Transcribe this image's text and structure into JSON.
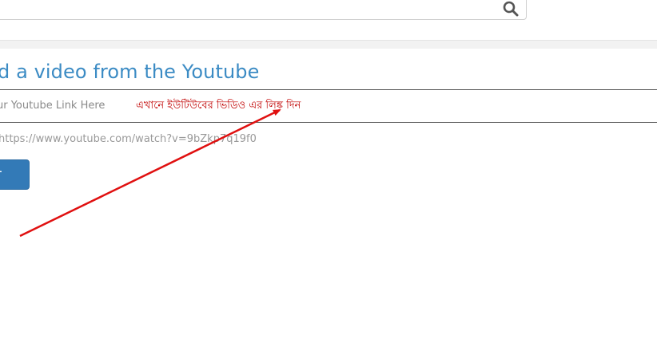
{
  "header": {
    "search": {
      "value": "",
      "icon": "search-icon"
    }
  },
  "main": {
    "title": "d a video from the Youtube",
    "field_label": "ur Youtube Link Here",
    "annotation": "এখানে  ইউটিউবের ভিডিও এর লিঙ্ক দিন",
    "url_input": {
      "placeholder": "https://www.youtube.com/watch?v=9bZkp7q19f0",
      "value": ""
    },
    "submit_label": "T"
  },
  "colors": {
    "title": "#3b8bc4",
    "button": "#337ab7",
    "annotation": "#c00000",
    "arrow": "#e01010"
  }
}
